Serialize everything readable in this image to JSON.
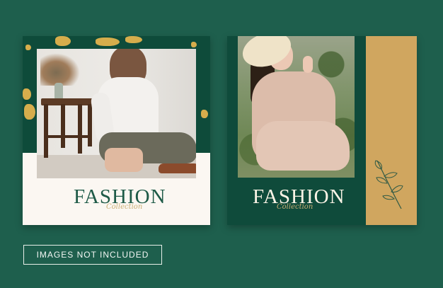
{
  "templates": [
    {
      "brand_title": "FASHION",
      "script_subtitle": "Collection"
    },
    {
      "brand_title": "FASHION",
      "script_subtitle": "Collection"
    }
  ],
  "notice": {
    "text": "IMAGES NOT INCLUDED"
  },
  "icons": {
    "leaf": "leaf-sprig-icon"
  },
  "colors": {
    "background": "#1e5f4d",
    "dark_green": "#0f4b3b",
    "gold": "#d0a65f",
    "cream": "#fbf7f2"
  }
}
